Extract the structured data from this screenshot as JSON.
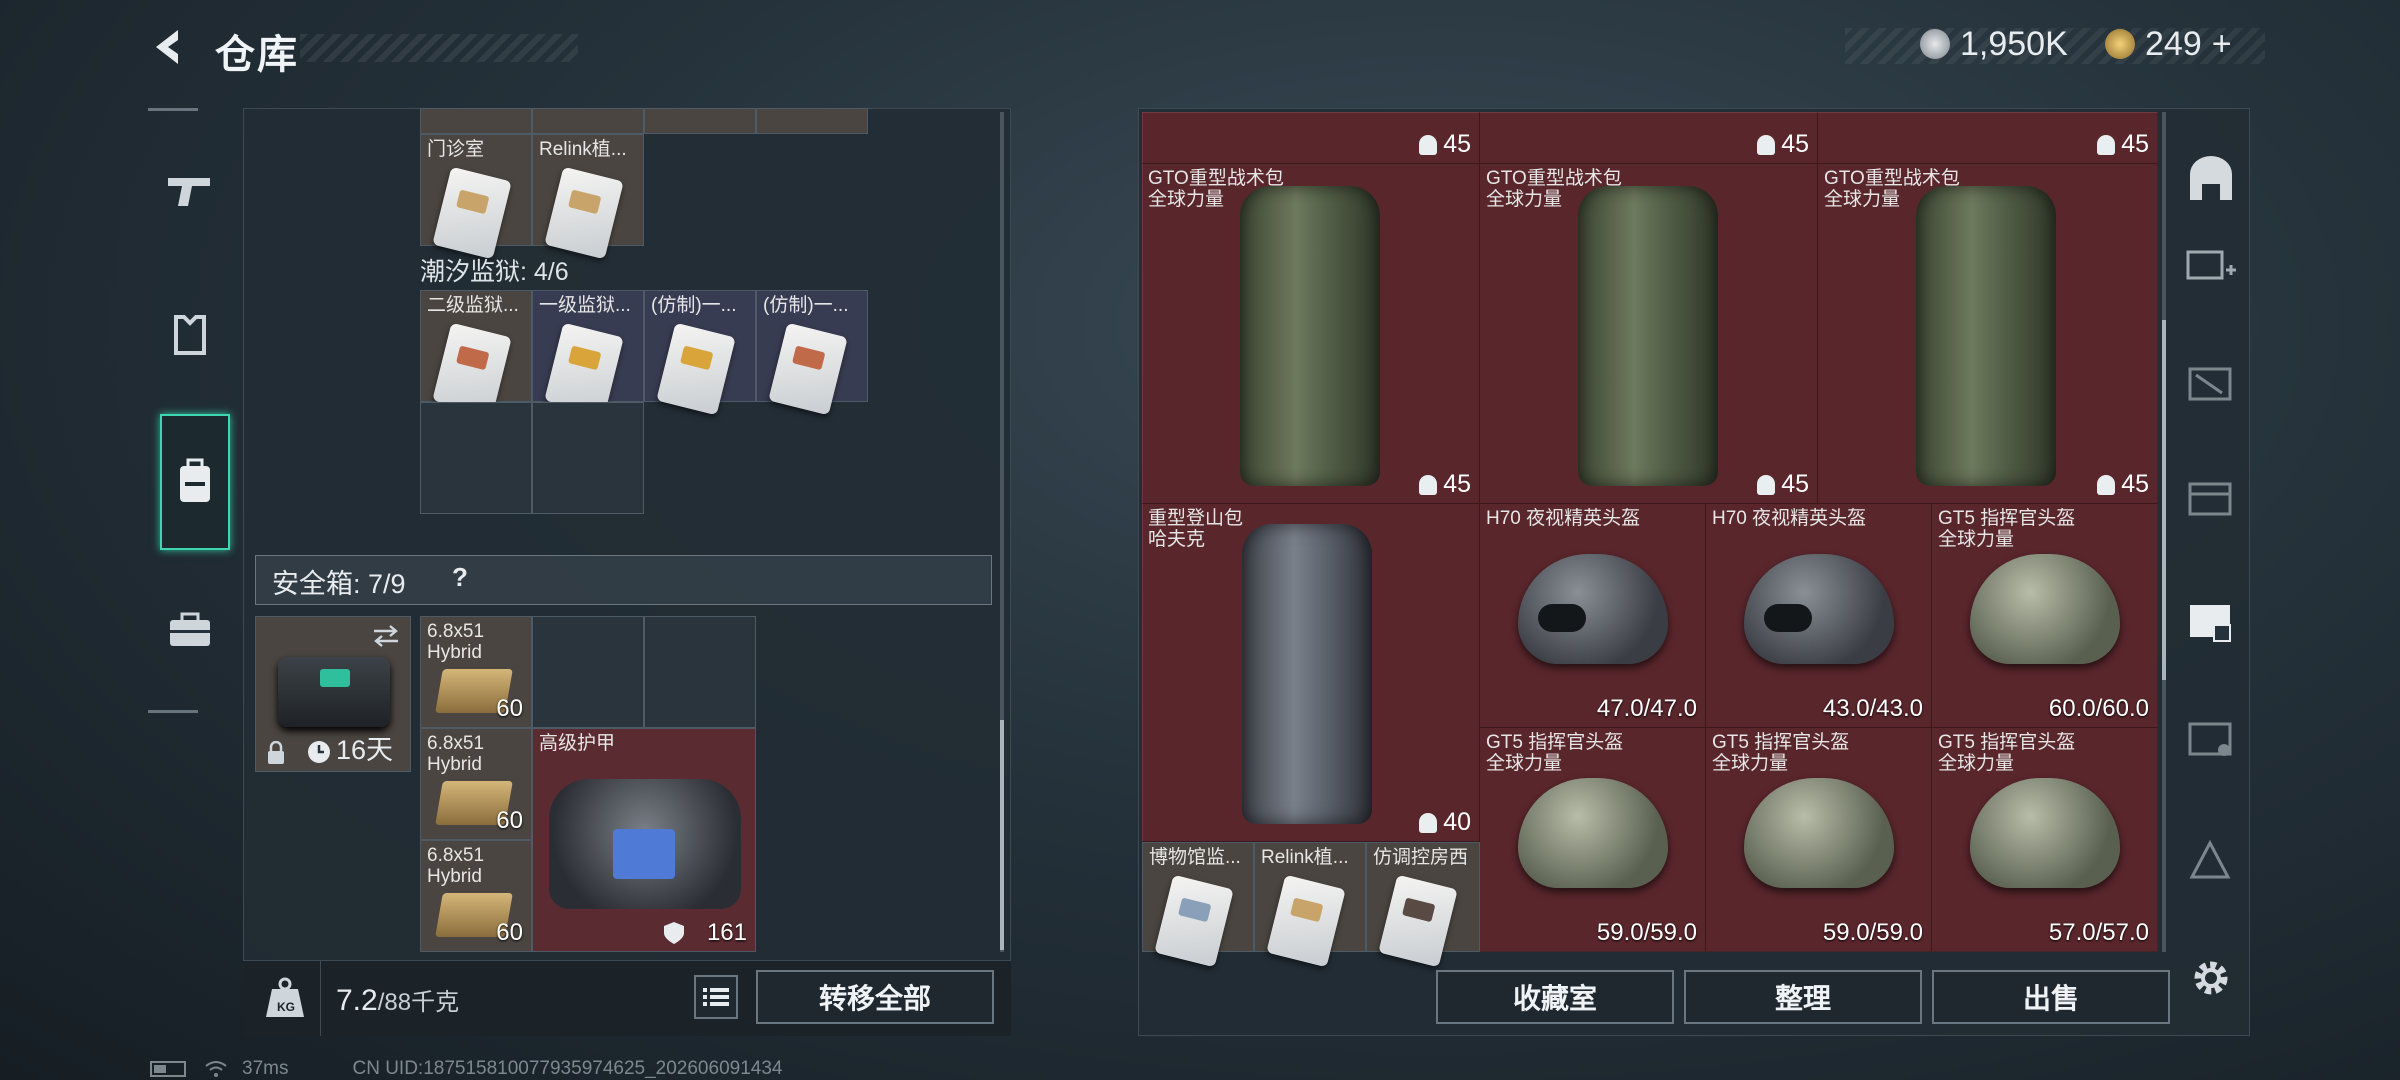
{
  "header": {
    "title": "仓库",
    "currency1": "1,950K",
    "currency2": "249",
    "plus": "+"
  },
  "left_panel": {
    "top_items": [
      {
        "label": "门诊室"
      },
      {
        "label": "Relink植..."
      }
    ],
    "prison_label": "潮汐监狱: 4/6",
    "prison_items": [
      {
        "label": "二级监狱..."
      },
      {
        "label": "一级监狱..."
      },
      {
        "label": "(仿制)一..."
      },
      {
        "label": "(仿制)一..."
      }
    ],
    "safe_label": "安全箱: 7/9",
    "safe_help": "?",
    "safe_timer": "16天",
    "safe_items": [
      {
        "label": "6.8x51\nHybrid",
        "count": "60"
      },
      {
        "label": "6.8x51\nHybrid",
        "count": "60"
      },
      {
        "label": "6.8x51\nHybrid",
        "count": "60"
      }
    ],
    "armor": {
      "label": "高级护甲",
      "durability": "161"
    },
    "weight": "7.2/88千克",
    "weight_value": "7.2",
    "weight_max": "/88千克",
    "transfer_all": "转移全部"
  },
  "right_panel": {
    "top_row": [
      {
        "weight": "45"
      },
      {
        "weight": "45"
      },
      {
        "weight": "45"
      }
    ],
    "backpacks": [
      {
        "label": "GTO重型战术包\n全球力量",
        "weight": "45"
      },
      {
        "label": "GTO重型战术包\n全球力量",
        "weight": "45"
      },
      {
        "label": "GTO重型战术包\n全球力量",
        "weight": "45"
      }
    ],
    "climbing_pack": {
      "label": "重型登山包\n哈夫克",
      "weight": "40"
    },
    "helmets_row1": [
      {
        "label": "H70 夜视精英头盔",
        "durability": "47.0/47.0"
      },
      {
        "label": "H70 夜视精英头盔",
        "durability": "43.0/43.0"
      },
      {
        "label": "GT5 指挥官头盔\n全球力量",
        "durability": "60.0/60.0"
      }
    ],
    "helmets_row2": [
      {
        "label": "GT5 指挥官头盔\n全球力量",
        "durability": "59.0/59.0"
      },
      {
        "label": "GT5 指挥官头盔\n全球力量",
        "durability": "59.0/59.0"
      },
      {
        "label": "GT5 指挥官头盔\n全球力量",
        "durability": "57.0/57.0"
      }
    ],
    "small_items": [
      {
        "label": "博物馆监..."
      },
      {
        "label": "Relink植..."
      },
      {
        "label": "仿调控房西"
      }
    ],
    "buttons": {
      "collection": "收藏室",
      "sort": "整理",
      "sell": "出售"
    }
  },
  "status_bar": {
    "ping": "37ms",
    "uid": "CN UID:18751581007793597462​5_202606091434"
  },
  "colors": {
    "accent": "#3fd6b2",
    "red_cell": "#5a2b30"
  }
}
